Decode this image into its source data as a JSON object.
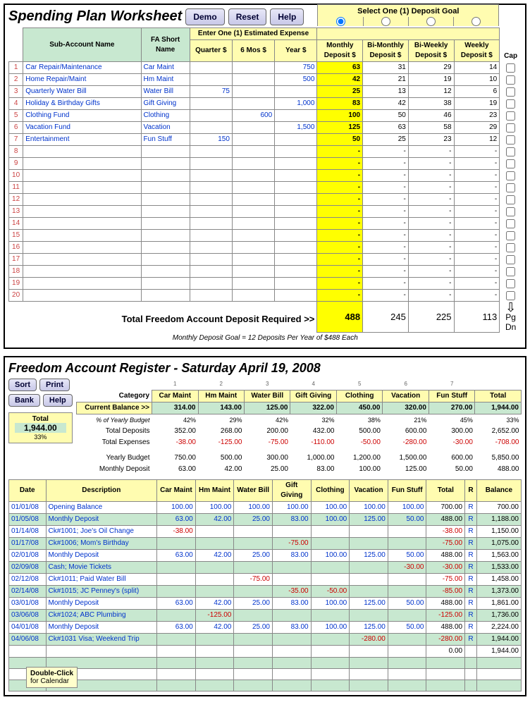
{
  "worksheet": {
    "title": "Spending Plan Worksheet",
    "btns": {
      "demo": "Demo",
      "reset": "Reset",
      "help": "Help"
    },
    "goal_header": "Select One (1) Deposit Goal",
    "col_sub": "Sub-Account Name",
    "col_fa": "FA Short Name",
    "exp_header": "Enter One (1) Estimated Expense",
    "col_q": "Quarter $",
    "col_6": "6 Mos $",
    "col_y": "Year $",
    "col_m": "Monthly Deposit $",
    "col_bm": "Bi-Monthly Deposit $",
    "col_bw": "Bi-Weekly Deposit $",
    "col_w": "Weekly Deposit $",
    "col_cap": "Cap",
    "rows": [
      {
        "n": "1",
        "name": "Car Repair/Maintenance",
        "fa": "Car Maint",
        "q": "",
        "s": "",
        "y": "750",
        "m": "63",
        "bm": "31",
        "bw": "29",
        "w": "14"
      },
      {
        "n": "2",
        "name": "Home Repair/Maint",
        "fa": "Hm Maint",
        "q": "",
        "s": "",
        "y": "500",
        "m": "42",
        "bm": "21",
        "bw": "19",
        "w": "10"
      },
      {
        "n": "3",
        "name": "Quarterly Water Bill",
        "fa": "Water Bill",
        "q": "75",
        "s": "",
        "y": "",
        "m": "25",
        "bm": "13",
        "bw": "12",
        "w": "6"
      },
      {
        "n": "4",
        "name": "Holiday & Birthday Gifts",
        "fa": "Gift Giving",
        "q": "",
        "s": "",
        "y": "1,000",
        "m": "83",
        "bm": "42",
        "bw": "38",
        "w": "19"
      },
      {
        "n": "5",
        "name": "Clothing Fund",
        "fa": "Clothing",
        "q": "",
        "s": "600",
        "y": "",
        "m": "100",
        "bm": "50",
        "bw": "46",
        "w": "23"
      },
      {
        "n": "6",
        "name": "Vacation Fund",
        "fa": "Vacation",
        "q": "",
        "s": "",
        "y": "1,500",
        "m": "125",
        "bm": "63",
        "bw": "58",
        "w": "29"
      },
      {
        "n": "7",
        "name": "Entertainment",
        "fa": "Fun Stuff",
        "q": "150",
        "s": "",
        "y": "",
        "m": "50",
        "bm": "25",
        "bw": "23",
        "w": "12"
      },
      {
        "n": "8"
      },
      {
        "n": "9"
      },
      {
        "n": "10"
      },
      {
        "n": "11"
      },
      {
        "n": "12"
      },
      {
        "n": "13"
      },
      {
        "n": "14"
      },
      {
        "n": "15"
      },
      {
        "n": "16"
      },
      {
        "n": "17"
      },
      {
        "n": "18"
      },
      {
        "n": "19"
      },
      {
        "n": "20"
      }
    ],
    "total_label": "Total Freedom Account Deposit Required  >>",
    "totals": {
      "m": "488",
      "bm": "245",
      "bw": "225",
      "w": "113"
    },
    "footnote": "Monthly Deposit Goal = 12 Deposits Per Year of $488 Each",
    "pgdn": "Pg Dn"
  },
  "register": {
    "title": "Freedom Account Register - Saturday April 19, 2008",
    "btns": {
      "sort": "Sort",
      "print": "Print",
      "bank": "Bank",
      "help": "Help"
    },
    "total_lbl": "Total",
    "total_val": "1,944.00",
    "total_pct": "33%",
    "labels": {
      "category": "Category",
      "curbal": "Current Balance >>",
      "pctyb": "% of Yearly Budget",
      "totdep": "Total Deposits",
      "totexp": "Total Expenses",
      "ybudget": "Yearly Budget",
      "mdep": "Monthly Deposit"
    },
    "nums": [
      "1",
      "2",
      "3",
      "4",
      "5",
      "6",
      "7",
      ""
    ],
    "cats": [
      "Car Maint",
      "Hm Maint",
      "Water Bill",
      "Gift Giving",
      "Clothing",
      "Vacation",
      "Fun Stuff",
      "Total"
    ],
    "curbal": [
      "314.00",
      "143.00",
      "125.00",
      "322.00",
      "450.00",
      "320.00",
      "270.00",
      "1,944.00"
    ],
    "pctyb": [
      "42%",
      "29%",
      "42%",
      "32%",
      "38%",
      "21%",
      "45%",
      "33%"
    ],
    "totdep": [
      "352.00",
      "268.00",
      "200.00",
      "432.00",
      "500.00",
      "600.00",
      "300.00",
      "2,652.00"
    ],
    "totexp": [
      "-38.00",
      "-125.00",
      "-75.00",
      "-110.00",
      "-50.00",
      "-280.00",
      "-30.00",
      "-708.00"
    ],
    "ybudget": [
      "750.00",
      "500.00",
      "300.00",
      "1,000.00",
      "1,200.00",
      "1,500.00",
      "600.00",
      "5,850.00"
    ],
    "mdep": [
      "63.00",
      "42.00",
      "25.00",
      "83.00",
      "100.00",
      "125.00",
      "50.00",
      "488.00"
    ],
    "hdr2": {
      "date": "Date",
      "desc": "Description",
      "r": "R",
      "bal": "Balance"
    },
    "tx": [
      {
        "d": "01/01/08",
        "desc": "Opening Balance",
        "v": [
          "100.00",
          "100.00",
          "100.00",
          "100.00",
          "100.00",
          "100.00",
          "100.00"
        ],
        "t": "700.00",
        "r": "R",
        "b": "700.00",
        "neg": []
      },
      {
        "d": "01/05/08",
        "desc": "Monthly Deposit",
        "g": 1,
        "v": [
          "63.00",
          "42.00",
          "25.00",
          "83.00",
          "100.00",
          "125.00",
          "50.00"
        ],
        "t": "488.00",
        "r": "R",
        "b": "1,188.00",
        "neg": []
      },
      {
        "d": "01/14/08",
        "desc": "Ck#1001; Joe's Oil Change",
        "v": [
          "-38.00",
          "",
          "",
          "",
          "",
          "",
          ""
        ],
        "t": "-38.00",
        "tn": 1,
        "r": "R",
        "b": "1,150.00",
        "neg": [
          0
        ]
      },
      {
        "d": "01/17/08",
        "desc": "Ck#1006; Mom's Birthday",
        "g": 1,
        "v": [
          "",
          "",
          "",
          "-75.00",
          "",
          "",
          ""
        ],
        "t": "-75.00",
        "tn": 1,
        "r": "R",
        "b": "1,075.00",
        "neg": [
          3
        ]
      },
      {
        "d": "02/01/08",
        "desc": "Monthly Deposit",
        "v": [
          "63.00",
          "42.00",
          "25.00",
          "83.00",
          "100.00",
          "125.00",
          "50.00"
        ],
        "t": "488.00",
        "r": "R",
        "b": "1,563.00",
        "neg": []
      },
      {
        "d": "02/09/08",
        "desc": "Cash; Movie Tickets",
        "g": 1,
        "v": [
          "",
          "",
          "",
          "",
          "",
          "",
          "-30.00"
        ],
        "t": "-30.00",
        "tn": 1,
        "r": "R",
        "b": "1,533.00",
        "neg": [
          6
        ]
      },
      {
        "d": "02/12/08",
        "desc": "Ck#1011; Paid Water Bill",
        "v": [
          "",
          "",
          "-75.00",
          "",
          "",
          "",
          ""
        ],
        "t": "-75.00",
        "tn": 1,
        "r": "R",
        "b": "1,458.00",
        "neg": [
          2
        ]
      },
      {
        "d": "02/14/08",
        "desc": "Ck#1015; JC Penney's (split)",
        "g": 1,
        "v": [
          "",
          "",
          "",
          "-35.00",
          "-50.00",
          "",
          ""
        ],
        "t": "-85.00",
        "tn": 1,
        "r": "R",
        "b": "1,373.00",
        "neg": [
          3,
          4
        ]
      },
      {
        "d": "03/01/08",
        "desc": "Monthly Deposit",
        "v": [
          "63.00",
          "42.00",
          "25.00",
          "83.00",
          "100.00",
          "125.00",
          "50.00"
        ],
        "t": "488.00",
        "r": "R",
        "b": "1,861.00",
        "neg": []
      },
      {
        "d": "03/06/08",
        "desc": "Ck#1024; ABC Plumbing",
        "g": 1,
        "v": [
          "",
          "-125.00",
          "",
          "",
          "",
          "",
          ""
        ],
        "t": "-125.00",
        "tn": 1,
        "r": "R",
        "b": "1,736.00",
        "neg": [
          1
        ]
      },
      {
        "d": "04/01/08",
        "desc": "Monthly Deposit",
        "v": [
          "63.00",
          "42.00",
          "25.00",
          "83.00",
          "100.00",
          "125.00",
          "50.00"
        ],
        "t": "488.00",
        "r": "R",
        "b": "2,224.00",
        "neg": []
      },
      {
        "d": "04/06/08",
        "desc": "Ck#1031 Visa; Weekend Trip",
        "g": 1,
        "v": [
          "",
          "",
          "",
          "",
          "",
          "-280.00",
          ""
        ],
        "t": "-280.00",
        "tn": 1,
        "r": "R",
        "b": "1,944.00",
        "neg": [
          5
        ]
      }
    ],
    "endrow": {
      "t": "0.00",
      "b": "1,944.00"
    },
    "tooltip1": "Double-Click",
    "tooltip2": "for Calendar"
  }
}
